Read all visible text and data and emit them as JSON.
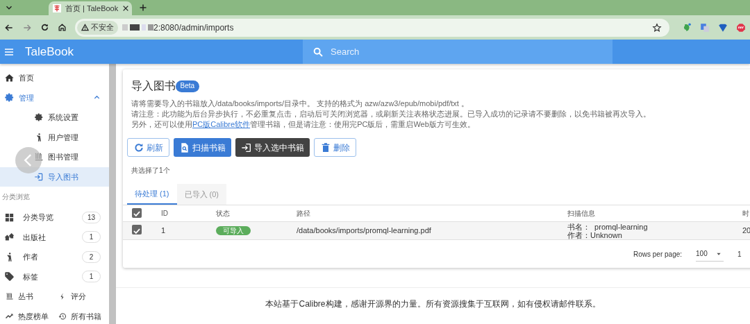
{
  "browser": {
    "tab_title": "首页 | TaleBook",
    "security_label": "不安全",
    "url": "2:8080/admin/imports"
  },
  "appbar": {
    "title": "TaleBook",
    "search_placeholder": "Search"
  },
  "sidebar": {
    "items": [
      {
        "label": "首页",
        "selected": false
      },
      {
        "label": "管理",
        "selected": false,
        "expanded": true,
        "children": [
          {
            "label": "系统设置",
            "selected": false
          },
          {
            "label": "用户管理",
            "selected": false
          },
          {
            "label": "图书管理",
            "selected": false
          },
          {
            "label": "导入图书",
            "selected": true
          }
        ]
      }
    ],
    "section_label": "分类浏览",
    "categories": [
      {
        "label": "分类导览",
        "count": "13"
      },
      {
        "label": "出版社",
        "count": "1"
      },
      {
        "label": "作者",
        "count": "2"
      },
      {
        "label": "标签",
        "count": "1"
      }
    ],
    "links": [
      {
        "label": "丛书"
      },
      {
        "label": "评分"
      },
      {
        "label": "热度榜单"
      },
      {
        "label": "所有书籍"
      }
    ]
  },
  "page": {
    "title": "导入图书",
    "badge": "Beta",
    "description": [
      {
        "text": "请将需要导入的书籍放入/data/books/imports/目录中。 支持的格式为 azw/azw3/epub/mobi/pdf/txt 。"
      },
      {
        "text": "请注意：此功能为后台异步执行，不必重复点击，启动后可关闭浏览器，或刷新关注表格状态进展。已导入成功的记录请不要删除，以免书籍被再次导入。"
      },
      {
        "text": "另外，还可以使用",
        "link": "PC版Calibre软件",
        "text_after": "管理书籍，但是请注意：使用完PC版后，需重启Web版方可生效。"
      }
    ],
    "buttons": [
      {
        "label": "刷新",
        "kind": "outline"
      },
      {
        "label": "扫描书籍",
        "kind": "primary"
      },
      {
        "label": "导入选中书籍",
        "kind": "dark"
      },
      {
        "label": "删除",
        "kind": "outline"
      }
    ],
    "selection_summary": "共选择了1个",
    "tabs": [
      {
        "label": "待处理 (1)",
        "selected": true
      },
      {
        "label": "已导入 (0)",
        "selected": false
      }
    ],
    "table": {
      "all_selected": true,
      "columns": [
        "ID",
        "状态",
        "路径",
        "扫描信息",
        "时"
      ],
      "rows": [
        {
          "selected": true,
          "id": "1",
          "status": "可导入",
          "path": "/data/books/imports/promql-learning.pdf",
          "scan_info": [
            "书名：  promql-learning",
            "作者：Unknown"
          ],
          "time": "20"
        }
      ]
    },
    "pagination": {
      "rows_per_page_label": "Rows per page:",
      "rows_per_page": "100",
      "page_info": "1"
    }
  },
  "footer": "本站基于Calibre构建，感谢开源界的力量。所有资源搜集于互联网，如有侵权请邮件联系。"
}
